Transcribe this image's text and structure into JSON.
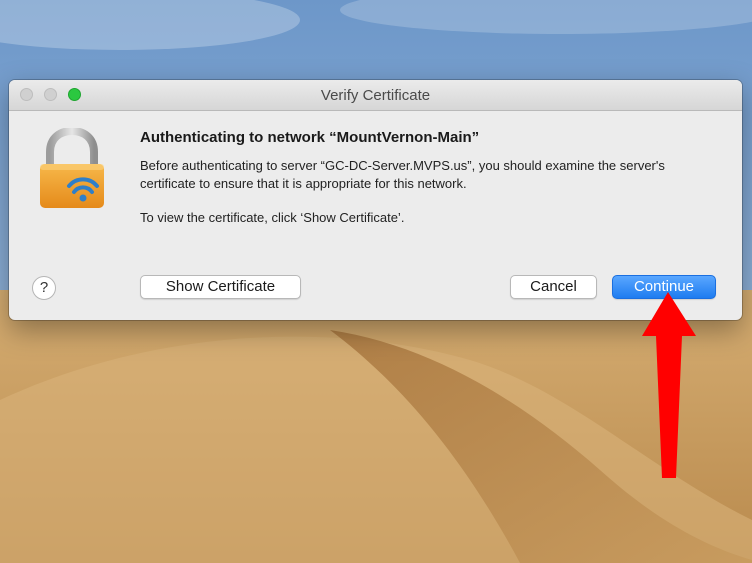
{
  "window": {
    "title": "Verify Certificate"
  },
  "dialog": {
    "heading": "Authenticating to network “MountVernon-Main”",
    "message": "Before authenticating to server “GC-DC-Server.MVPS.us”, you should examine the server's certificate to ensure that it is appropriate for this network.",
    "instruction": "To view the certificate, click ‘Show Certificate’."
  },
  "buttons": {
    "help_label": "?",
    "show_certificate": "Show Certificate",
    "cancel": "Cancel",
    "continue": "Continue"
  },
  "colors": {
    "continue_button": "#1e7cf0",
    "annotation_arrow": "#ff0000",
    "lock_body": "#f0a22d"
  }
}
